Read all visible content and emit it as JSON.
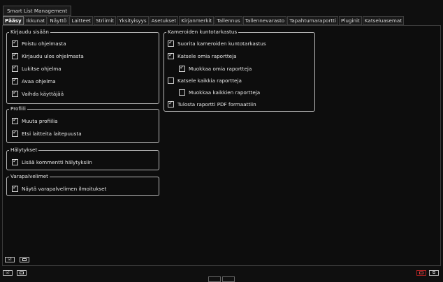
{
  "window": {
    "title": "Smart List Management"
  },
  "tabs": [
    {
      "label": "Pääsy"
    },
    {
      "label": "Ikkunat"
    },
    {
      "label": "Näyttö"
    },
    {
      "label": "Laitteet"
    },
    {
      "label": "Striimit"
    },
    {
      "label": "Yksityisyys"
    },
    {
      "label": "Asetukset"
    },
    {
      "label": "Kirjanmerkit"
    },
    {
      "label": "Tallennus"
    },
    {
      "label": "Tallennevarasto"
    },
    {
      "label": "Tapahtumaraportti"
    },
    {
      "label": "Pluginit"
    },
    {
      "label": "Katseluasemat"
    }
  ],
  "groups": {
    "kirjaudu": {
      "title": "Kirjaudu sisään",
      "items": [
        {
          "label": "Poistu ohjelmasta",
          "checked": true
        },
        {
          "label": "Kirjaudu ulos ohjelmasta",
          "checked": true
        },
        {
          "label": "Lukitse ohjelma",
          "checked": true
        },
        {
          "label": "Avaa ohjelma",
          "checked": true
        },
        {
          "label": "Vaihda käyttäjää",
          "checked": true
        }
      ]
    },
    "profiili": {
      "title": "Profiili",
      "items": [
        {
          "label": "Muuta profiilia",
          "checked": true
        },
        {
          "label": "Etsi laitteita laitepuusta",
          "checked": true
        }
      ]
    },
    "halytykset": {
      "title": "Hälytykset",
      "items": [
        {
          "label": "Lisää kommentti hälytyksiin",
          "checked": true
        }
      ]
    },
    "varapalvelimet": {
      "title": "Varapalvelimet",
      "items": [
        {
          "label": "Näytä varapalvelimen ilmoitukset",
          "checked": true
        }
      ]
    },
    "kamerat": {
      "title": "Kameroiden kuntotarkastus",
      "items": [
        {
          "label": "Suorita kameroiden kuntotarkastus",
          "checked": true
        },
        {
          "label": "Katsele omia raportteja",
          "checked": true
        },
        {
          "label": "Muokkaa omia raportteja",
          "checked": true
        },
        {
          "label": "Katsele kaikkia raportteja",
          "checked": false
        },
        {
          "label": "Muokkaa kaikkien raportteja",
          "checked": false
        },
        {
          "label": "Tulosta raportti PDF formaattiin",
          "checked": true
        }
      ]
    }
  },
  "icons": {
    "check_all": "check-all-icon",
    "uncheck_all": "uncheck-all-icon",
    "restore": "restore-icon",
    "popout": "popout-icon"
  },
  "colors": {
    "accent_red": "#b02020"
  }
}
